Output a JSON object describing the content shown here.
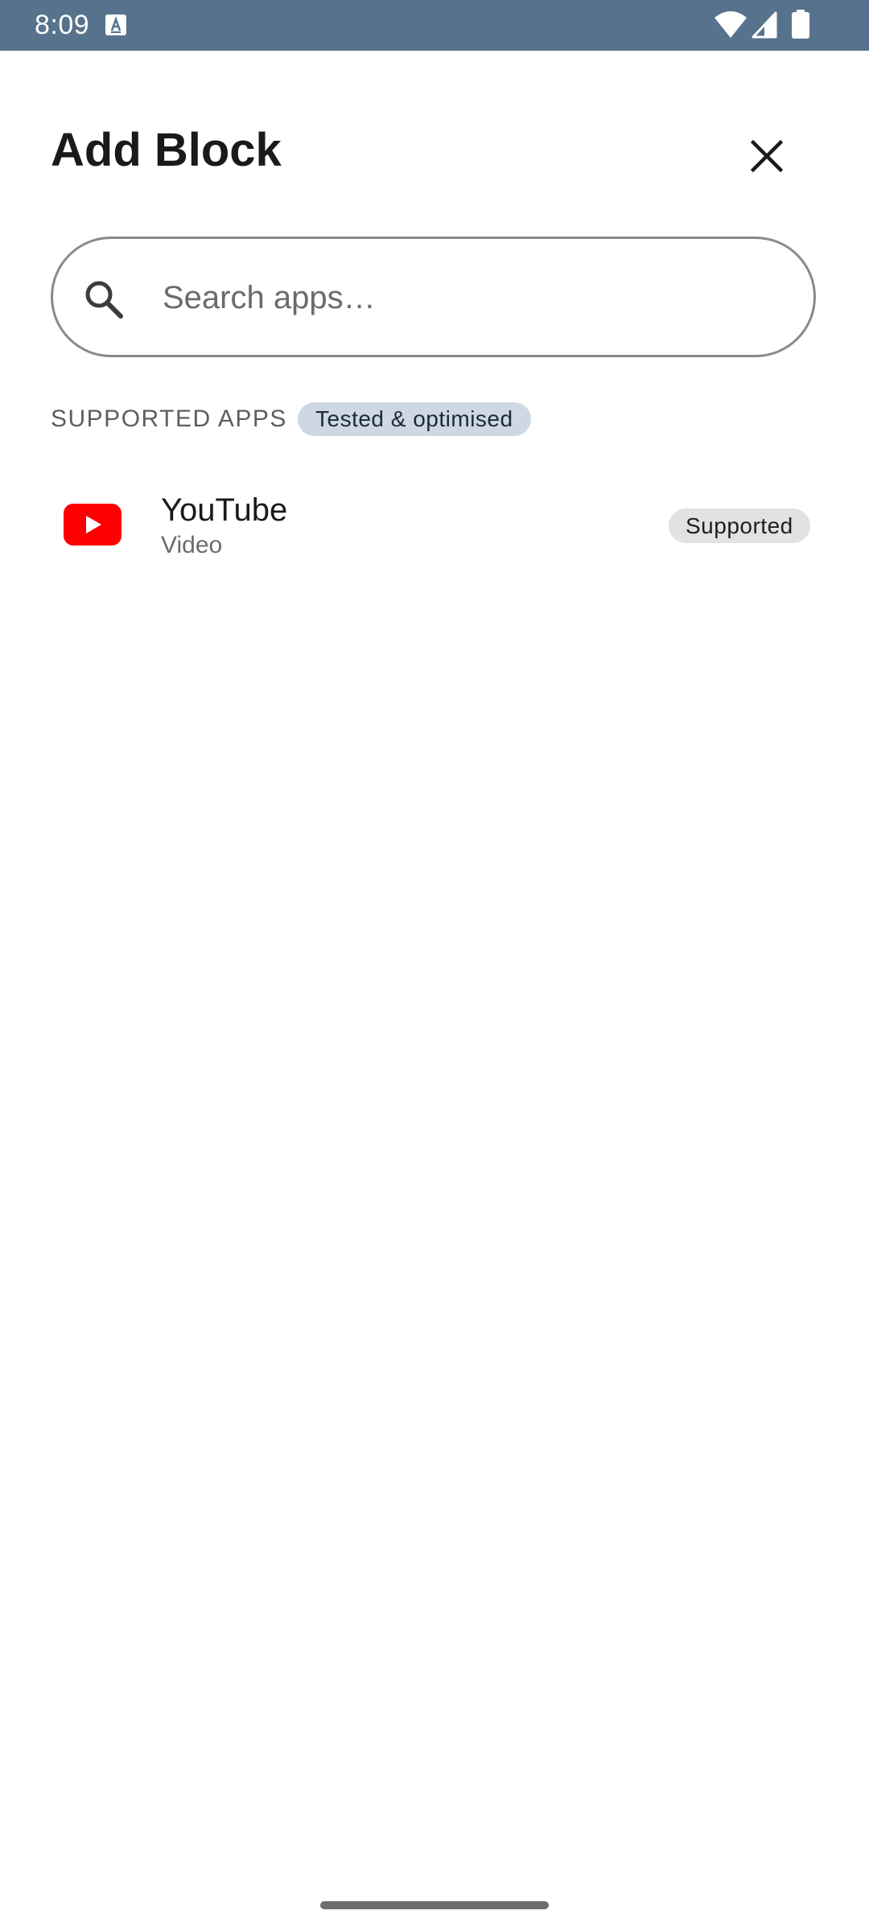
{
  "status_bar": {
    "time": "8:09",
    "icons": [
      "keyboard-a-icon",
      "wifi-icon",
      "signal-icon",
      "battery-icon"
    ],
    "background": "#56728c"
  },
  "header": {
    "title": "Add Block",
    "close_icon": "close-icon"
  },
  "search": {
    "placeholder": "Search apps…",
    "value": "",
    "icon": "search-icon"
  },
  "section": {
    "label": "SUPPORTED APPS",
    "badge": "Tested & optimised"
  },
  "apps": [
    {
      "name": "YouTube",
      "category": "Video",
      "status": "Supported",
      "icon": "youtube-icon",
      "icon_color": "#ff0000"
    }
  ]
}
